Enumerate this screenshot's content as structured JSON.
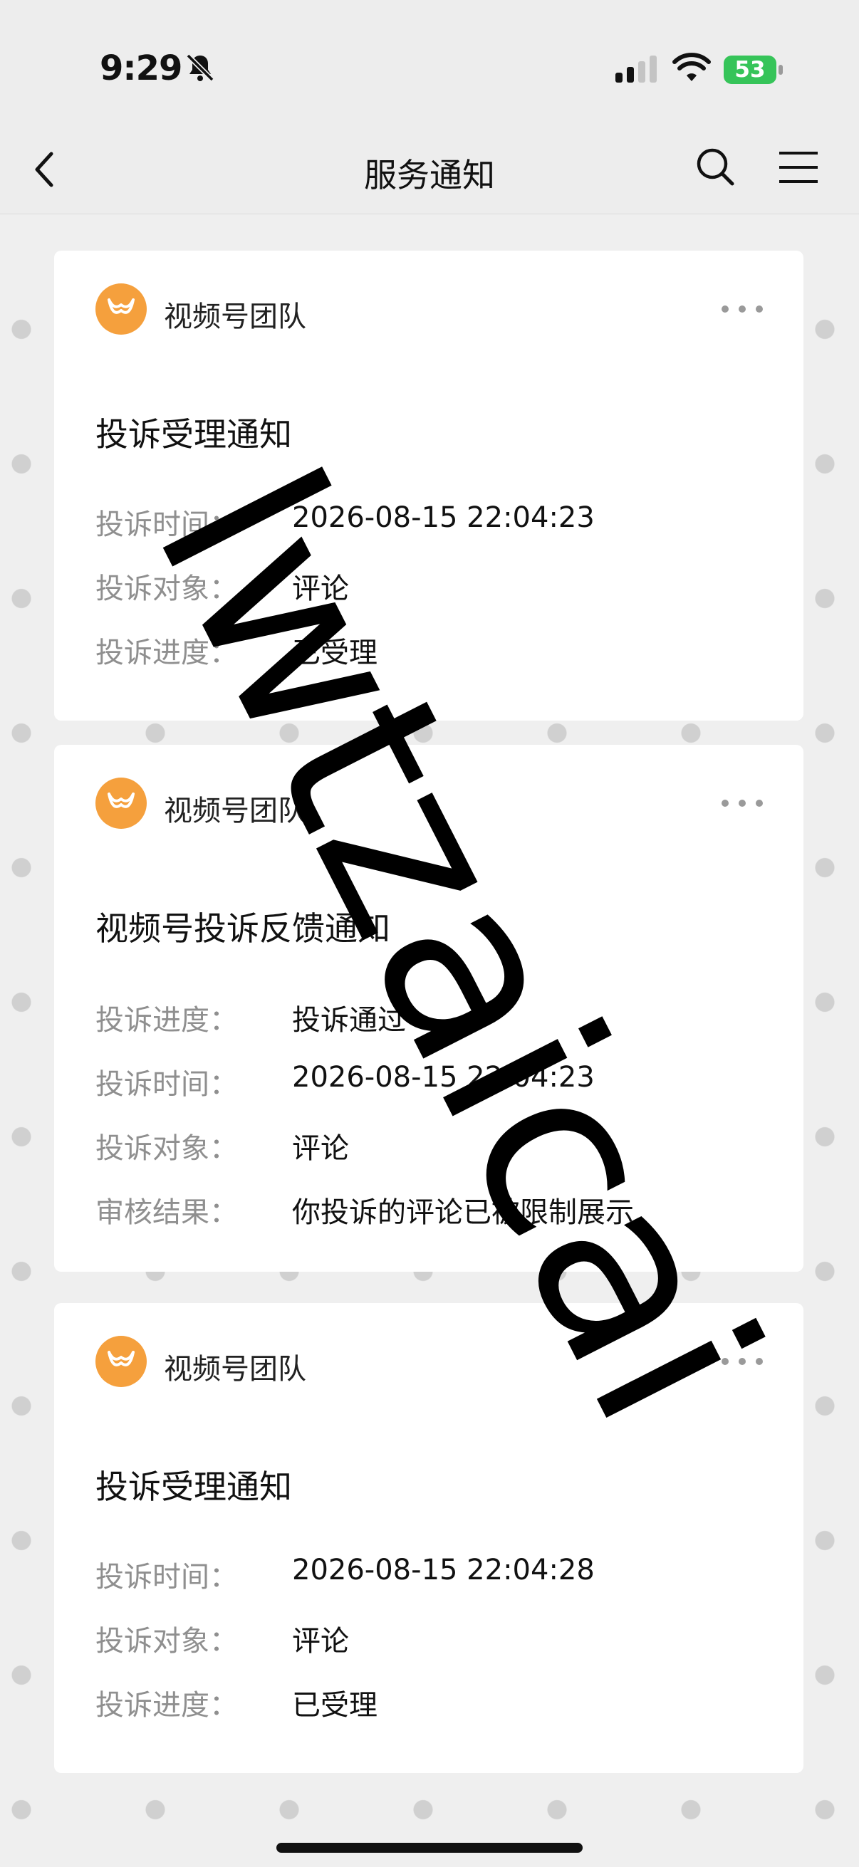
{
  "status_bar": {
    "time": "9:29",
    "battery": "53",
    "icons": [
      "bell-slash-icon",
      "cellular-signal-icon",
      "wifi-icon",
      "battery-charging-icon"
    ]
  },
  "nav": {
    "title": "服务通知",
    "icons": [
      "back-chevron-icon",
      "search-icon",
      "menu-icon"
    ]
  },
  "cards": [
    {
      "sender": "视频号团队",
      "title": "投诉受理通知",
      "rows": [
        {
          "label": "投诉时间：",
          "value": "2026-08-15 22:04:23"
        },
        {
          "label": "投诉对象：",
          "value": "评论"
        },
        {
          "label": "投诉进度：",
          "value": "已受理"
        }
      ]
    },
    {
      "sender": "视频号团队",
      "title": "视频号投诉反馈通知",
      "rows": [
        {
          "label": "投诉进度：",
          "value": "投诉通过"
        },
        {
          "label": "投诉时间：",
          "value": "2026-08-15 22:04:23"
        },
        {
          "label": "投诉对象：",
          "value": "评论"
        },
        {
          "label": "审核结果：",
          "value": "你投诉的评论已被限制展示"
        }
      ]
    },
    {
      "sender": "视频号团队",
      "title": "投诉受理通知",
      "rows": [
        {
          "label": "投诉时间：",
          "value": "2026-08-15 22:04:28"
        },
        {
          "label": "投诉对象：",
          "value": "评论"
        },
        {
          "label": "投诉进度：",
          "value": "已受理"
        }
      ]
    }
  ],
  "watermark": "lwtzaicai",
  "colors": {
    "accent_logo": "#f5a03d",
    "background": "#efefef",
    "battery": "#36c459"
  }
}
